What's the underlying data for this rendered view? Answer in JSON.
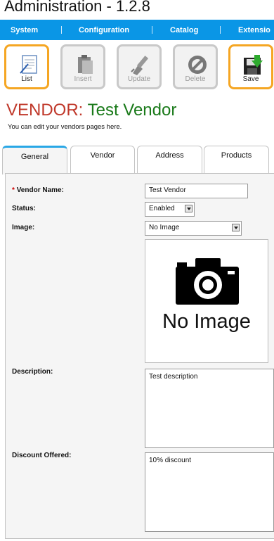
{
  "app": {
    "title": "Administration - 1.2.8"
  },
  "menu": [
    "System",
    "Configuration",
    "Catalog",
    "Extensio"
  ],
  "toolbar": [
    {
      "label": "List",
      "icon": "list-icon",
      "active": true
    },
    {
      "label": "Insert",
      "icon": "insert-icon",
      "active": false
    },
    {
      "label": "Update",
      "icon": "update-icon",
      "active": false
    },
    {
      "label": "Delete",
      "icon": "delete-icon",
      "active": false
    },
    {
      "label": "Save",
      "icon": "save-icon",
      "active": true
    }
  ],
  "heading": {
    "prefix": "VENDOR:",
    "name": "Test Vendor",
    "subtitle": "You can edit your vendors pages here."
  },
  "tabs": [
    "General",
    "Vendor",
    "Address",
    "Products"
  ],
  "form": {
    "required_mark": "*",
    "vendor_name_label": "Vendor Name:",
    "vendor_name_value": "Test Vendor",
    "status_label": "Status:",
    "status_value": "Enabled",
    "image_label": "Image:",
    "image_value": "No Image",
    "image_placeholder_text": "No Image",
    "description_label": "Description:",
    "description_value": "Test description",
    "discount_label": "Discount Offered:",
    "discount_value": "10% discount"
  },
  "colors": {
    "menubar": "#0a96e6",
    "active_border": "#f5a623",
    "heading_key": "#c0392b",
    "heading_value": "#1a7a1a",
    "tab_active_top": "#29a7e6"
  }
}
